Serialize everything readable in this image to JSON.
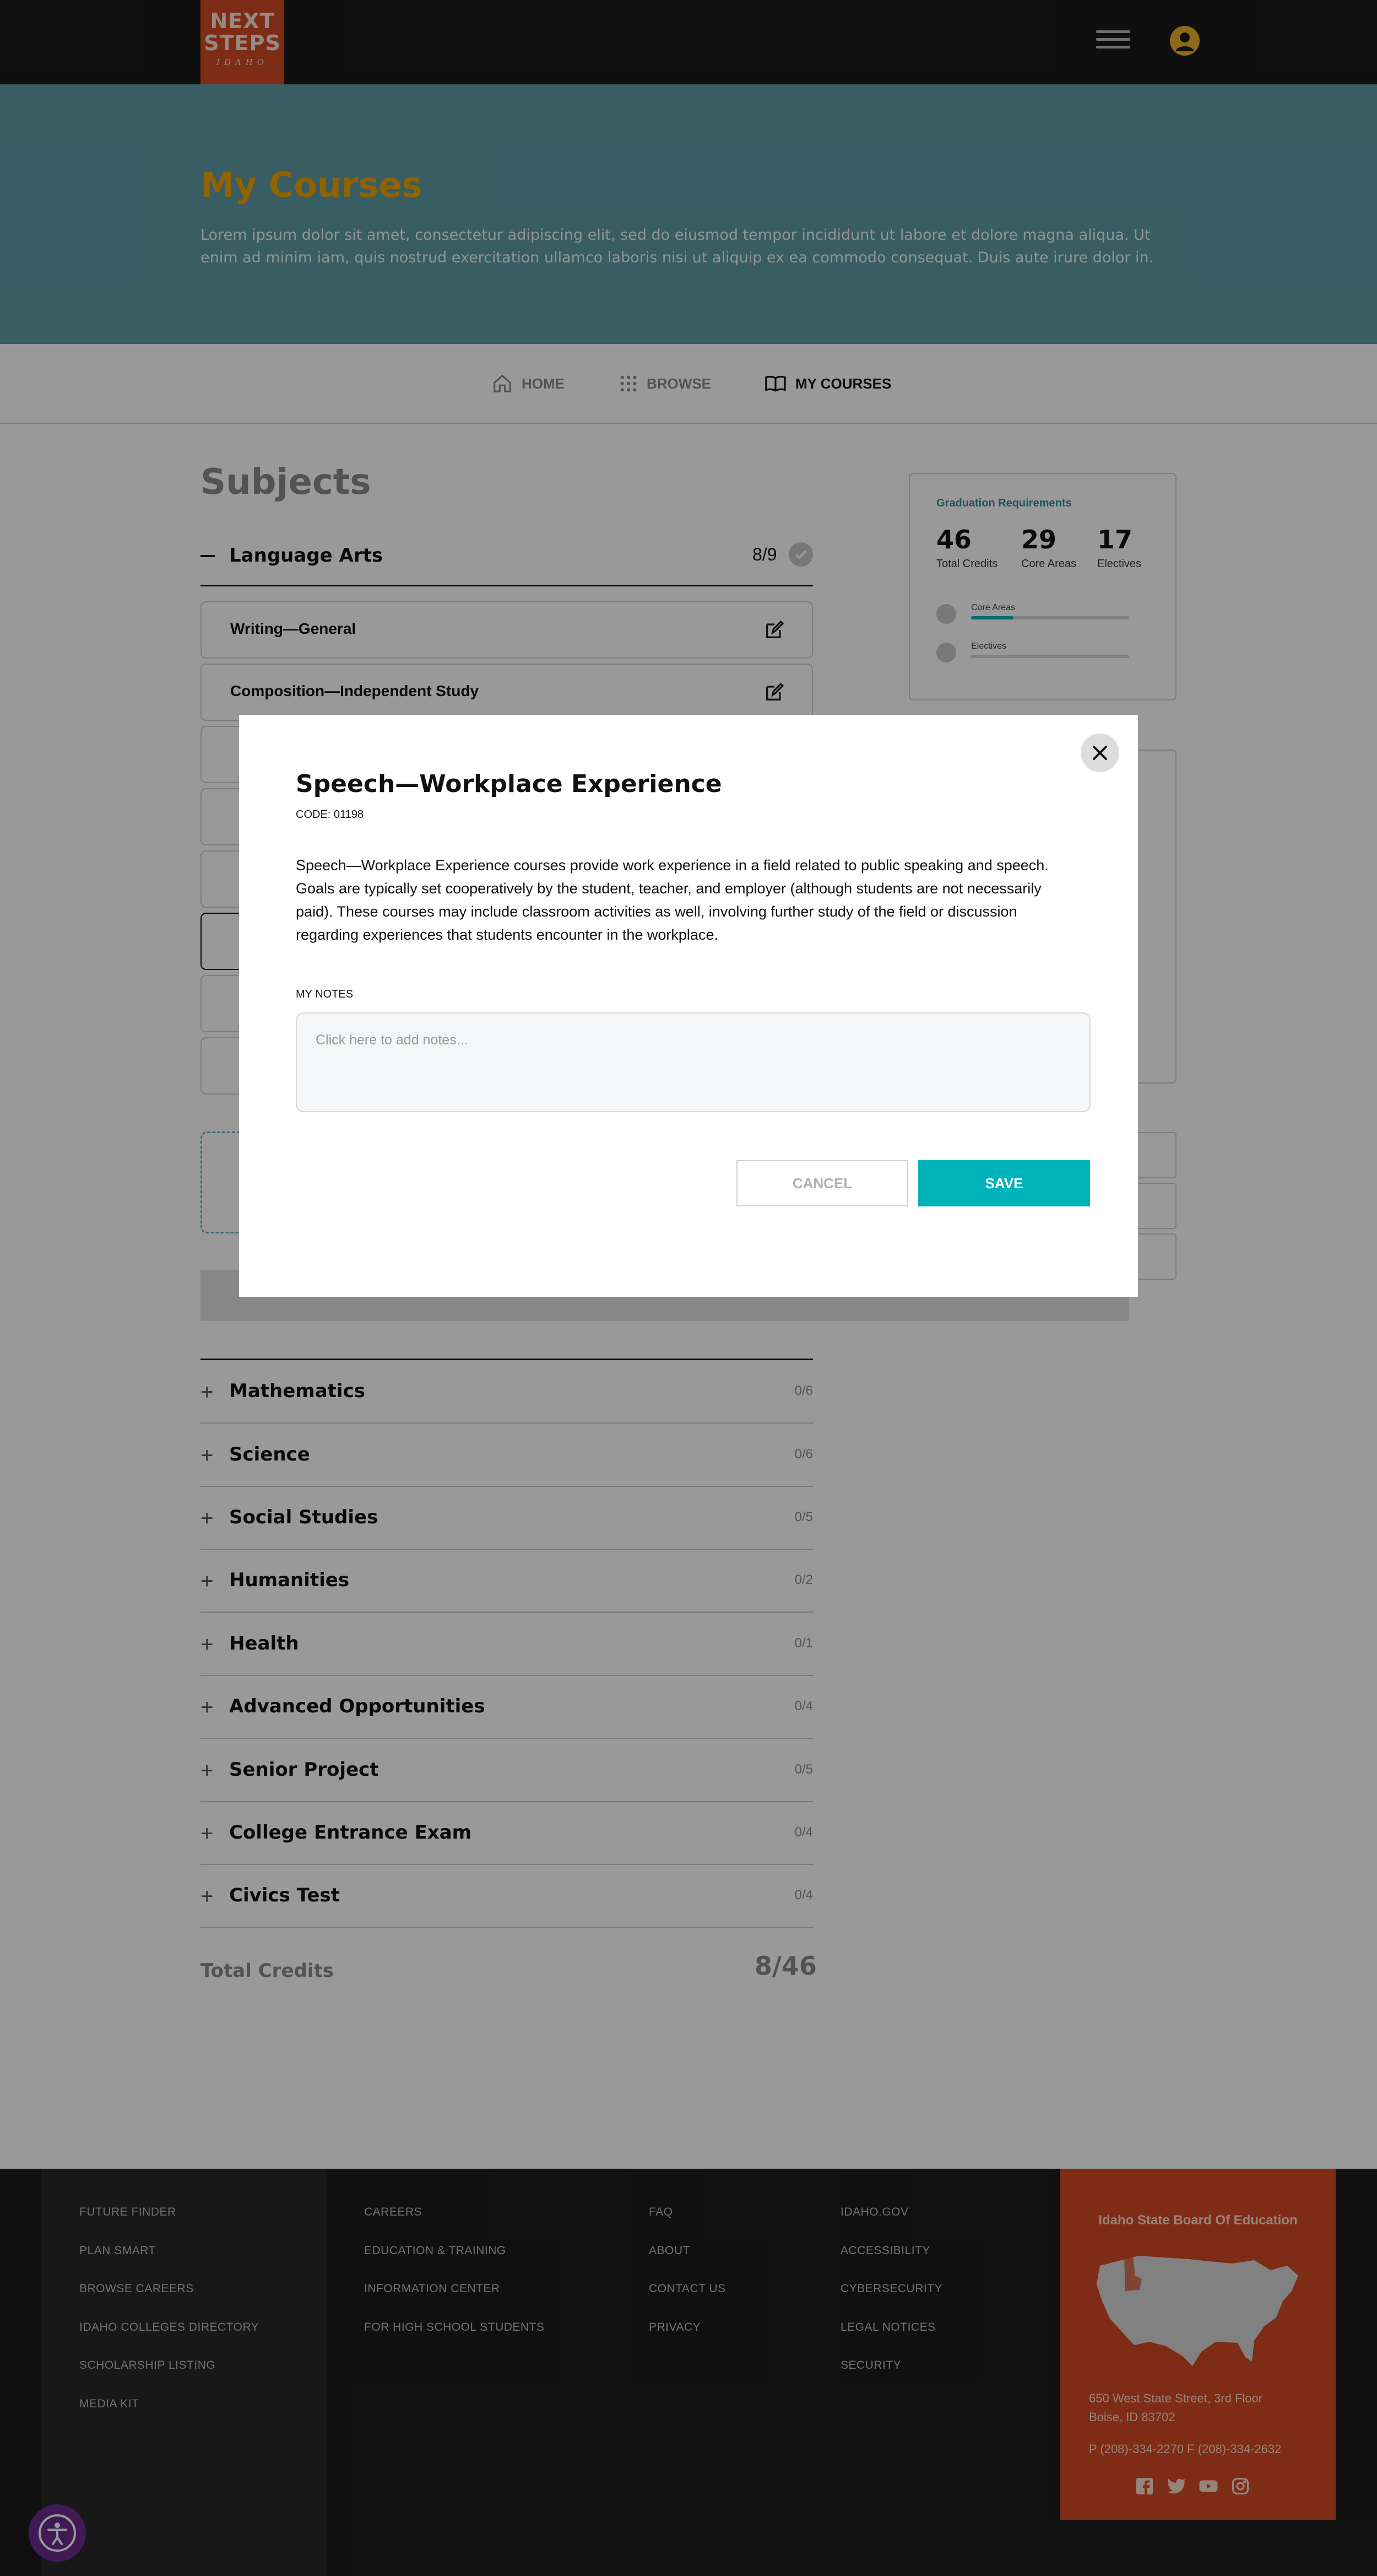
{
  "brand": {
    "logo_line1": "NEXT",
    "logo_line2": "STEPS",
    "logo_line3": "IDAHO"
  },
  "hero": {
    "title": "My Courses",
    "description": "Lorem ipsum dolor sit amet, consectetur adipiscing elit, sed do eiusmod tempor incididunt ut labore et dolore magna aliqua. Ut enim ad minim iam, quis nostrud exercitation ullamco laboris nisi ut aliquip ex ea commodo consequat. Duis aute irure dolor in."
  },
  "nav": {
    "items": [
      {
        "label": "HOME",
        "icon": "home-icon",
        "active": false
      },
      {
        "label": "BROWSE",
        "icon": "grid-icon",
        "active": false
      },
      {
        "label": "MY COURSES",
        "icon": "book-icon",
        "active": true
      }
    ]
  },
  "subjects": {
    "title": "Subjects",
    "expanded": {
      "name": "Language Arts",
      "count": "8/9",
      "courses": [
        "Writing—General",
        "Composition—Independent Study"
      ]
    },
    "collapsed": [
      {
        "name": "Mathematics",
        "count": "0/6"
      },
      {
        "name": "Science",
        "count": "0/6"
      },
      {
        "name": "Social Studies",
        "count": "0/5"
      },
      {
        "name": "Humanities",
        "count": "0/2"
      },
      {
        "name": "Health",
        "count": "0/1"
      },
      {
        "name": "Advanced Opportunities",
        "count": "0/4"
      },
      {
        "name": "Senior Project",
        "count": "0/5"
      },
      {
        "name": "College Entrance Exam",
        "count": "0/4"
      },
      {
        "name": "Civics Test",
        "count": "0/4"
      }
    ],
    "total_label": "Total Credits",
    "total_value": "8/46"
  },
  "graduation": {
    "title": "Graduation Requirements",
    "stats": [
      {
        "value": "46",
        "label": "Total Credits"
      },
      {
        "value": "29",
        "label": "Core Areas"
      },
      {
        "value": "17",
        "label": "Electives"
      }
    ],
    "progress": [
      {
        "label": "Core Areas",
        "fraction": 0.27
      },
      {
        "label": "Electives",
        "fraction": 0
      }
    ]
  },
  "modal": {
    "title": "Speech—Workplace Experience",
    "code": "CODE: 01198",
    "description": "Speech—Workplace Experience courses provide work experience in a field related to public speaking and speech. Goals are typically set cooperatively by the student, teacher, and employer (although students are not necessarily paid). These courses may include classroom activities as well, involving further study of the field or discussion regarding experiences that students encounter in the workplace.",
    "notes_label": "MY NOTES",
    "notes_placeholder": "Click here to add notes...",
    "cancel_label": "CANCEL",
    "save_label": "SAVE"
  },
  "footer": {
    "col1": [
      "FUTURE FINDER",
      "PLAN SMART",
      "BROWSE CAREERS",
      "IDAHO COLLEGES DIRECTORY",
      "SCHOLARSHIP LISTING",
      "MEDIA KIT"
    ],
    "col2": [
      "CAREERS",
      "EDUCATION & TRAINING",
      "INFORMATION CENTER",
      "FOR HIGH SCHOOL STUDENTS"
    ],
    "col3": [
      "FAQ",
      "ABOUT",
      "CONTACT US",
      "PRIVACY"
    ],
    "col4": [
      "IDAHO.GOV",
      "ACCESSIBILITY",
      "CYBERSECURITY",
      "LEGAL NOTICES",
      "SECURITY"
    ],
    "org_name": "Idaho State Board Of Education",
    "address_line1": "650 West State Street, 3rd Floor",
    "address_line2": "Boise, ID 83702",
    "phone": "P (208)-334-2270  F (208)-334-2632",
    "social": [
      "facebook-icon",
      "twitter-icon",
      "youtube-icon",
      "instagram-icon"
    ]
  },
  "colors": {
    "header_bg": "#1a1a1a",
    "logo_bg": "#d24a26",
    "hero_bg": "#5e9ba6",
    "hero_title": "#f0a400",
    "accent_teal": "#00b2b9",
    "footer_orange": "#d24a26",
    "a11y_purple": "#6b2c91"
  }
}
